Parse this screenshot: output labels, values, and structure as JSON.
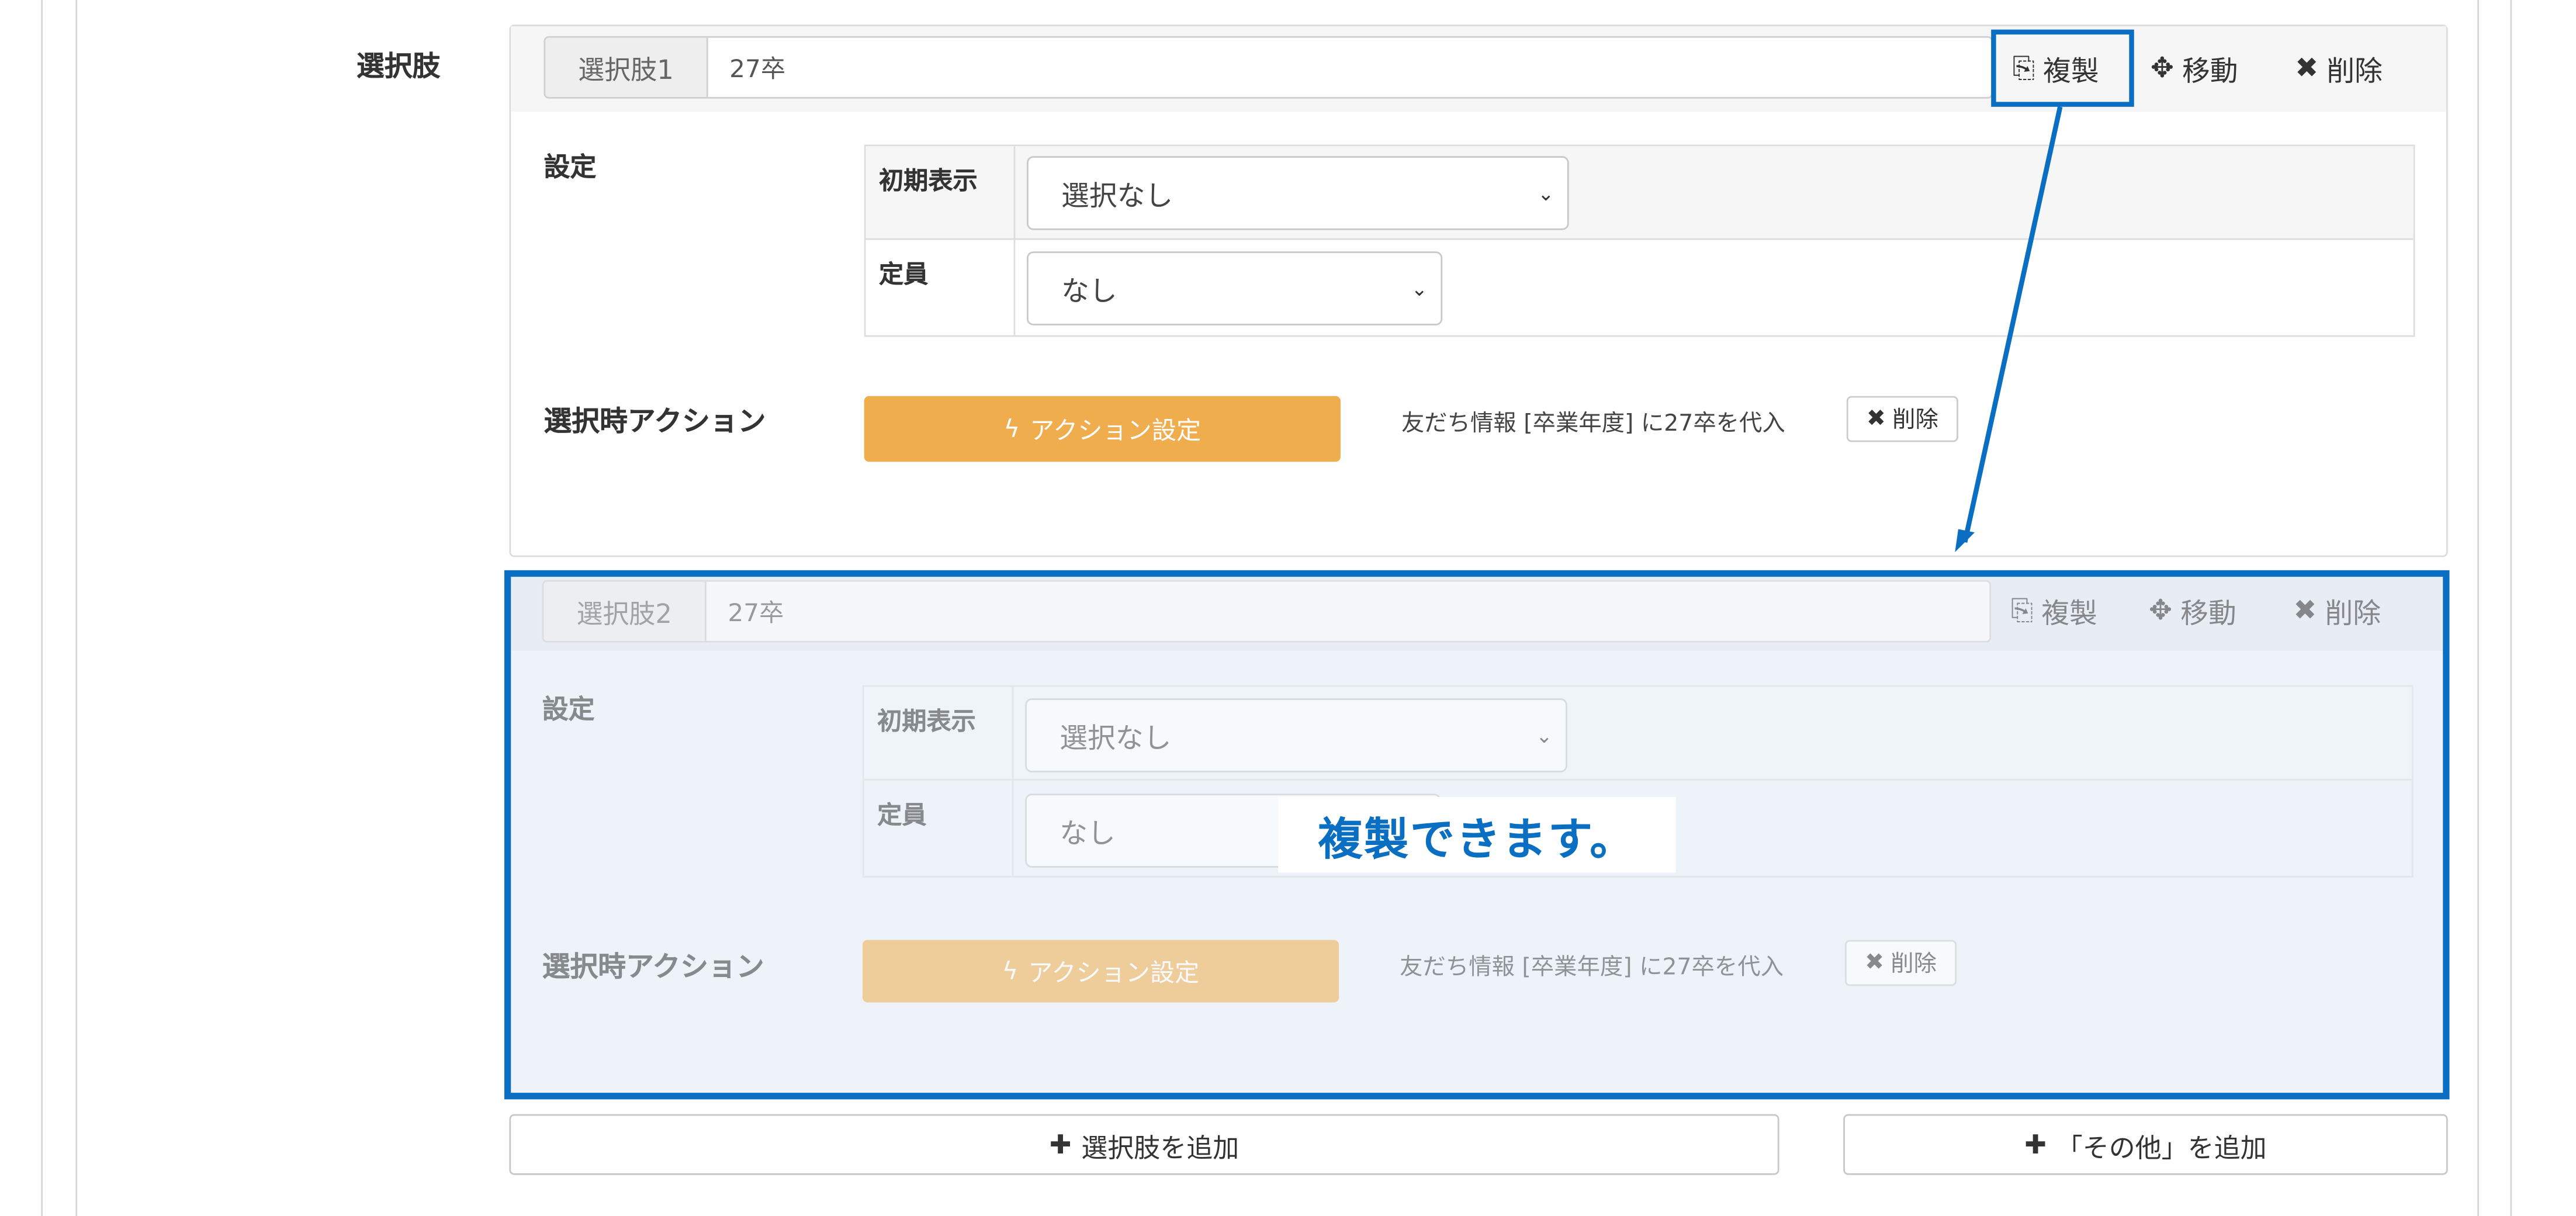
{
  "field_label": "選択肢",
  "choices": [
    {
      "addon": "選択肢1",
      "value": "27卒",
      "tools": {
        "copy": "複製",
        "move": "移動",
        "delete": "削除"
      },
      "settings_label": "設定",
      "rows": [
        {
          "label": "初期表示",
          "value": "選択なし"
        },
        {
          "label": "定員",
          "value": "なし"
        }
      ],
      "action_label": "選択時アクション",
      "action_button": "アクション設定",
      "action_note": "友だち情報 [卒業年度] に27卒を代入",
      "action_delete": "削除"
    },
    {
      "addon": "選択肢2",
      "value": "27卒",
      "tools": {
        "copy": "複製",
        "move": "移動",
        "delete": "削除"
      },
      "settings_label": "設定",
      "rows": [
        {
          "label": "初期表示",
          "value": "選択なし"
        },
        {
          "label": "定員",
          "value": "なし"
        }
      ],
      "action_label": "選択時アクション",
      "action_button": "アクション設定",
      "action_note": "友だち情報 [卒業年度] に27卒を代入",
      "action_delete": "削除"
    }
  ],
  "add_choice_button": "選択肢を追加",
  "add_other_button": "「その他」を追加",
  "annotation_text": "複製できます。",
  "colors": {
    "highlight": "#0a6fc2",
    "action": "#f0ad4e"
  },
  "icons": [
    "copy-icon",
    "move-icon",
    "delete-icon",
    "bolt-icon",
    "plus-icon",
    "chevron-down-icon"
  ]
}
